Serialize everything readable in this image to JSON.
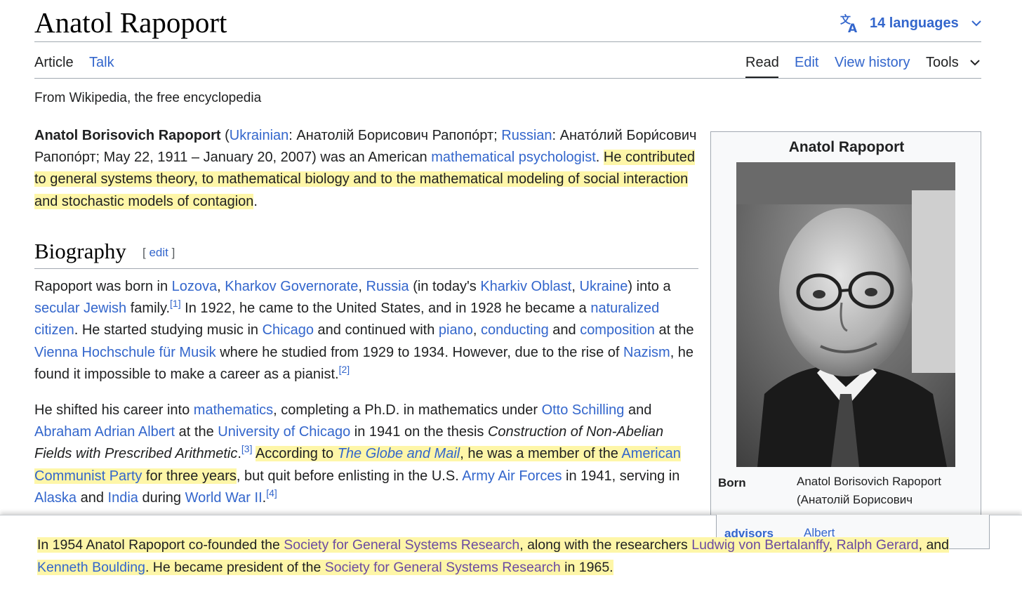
{
  "header": {
    "title": "Anatol Rapoport",
    "languages": "14 languages"
  },
  "tabs": {
    "article": "Article",
    "talk": "Talk",
    "read": "Read",
    "edit": "Edit",
    "history": "View history",
    "tools": "Tools"
  },
  "tagline": "From Wikipedia, the free encyclopedia",
  "lead": {
    "name": "Anatol Borisovich Rapoport",
    "ukr_link": "Ukrainian",
    "ukr_text": ": Анатолій Борисович Рапопо́рт; ",
    "rus_link": "Russian",
    "rus_text": ": Анато́лий Бори́сович Рапопо́рт; May 22, 1911 – January 20, 2007) was an American ",
    "psych_link": "mathematical psychologist",
    "hl_1": "He contributed to general systems theory, to mathematical biology and to the mathematical modeling of social interaction and stochastic models of contagion"
  },
  "biography": {
    "heading": "Biography",
    "edit_label": "edit",
    "p1": {
      "t1": "Rapoport was born in ",
      "l_lozova": "Lozova",
      "l_kharkov": "Kharkov Governorate",
      "l_russia": "Russia",
      "t2": " (in today's ",
      "l_oblast": "Kharkiv Oblast",
      "l_ukraine": "Ukraine",
      "t3": ") into a ",
      "l_secular": "secular Jewish",
      "t4": " family.",
      "ref1": "[1]",
      "t5": " In 1922, he came to the United States, and in 1928 he became a ",
      "l_natural": "naturalized citizen",
      "t6": ". He started studying music in ",
      "l_chicago": "Chicago",
      "t7": " and continued with ",
      "l_piano": "piano",
      "l_conducting": "conducting",
      "t8": " and ",
      "l_composition": "composition",
      "t9": " at the ",
      "l_vienna": "Vienna Hochschule für Musik",
      "t10": " where he studied from 1929 to 1934. However, due to the rise of ",
      "l_nazism": "Nazism",
      "t11": ", he found it impossible to make a career as a pianist.",
      "ref2": "[2]"
    },
    "p2": {
      "t1": "He shifted his career into ",
      "l_math": "mathematics",
      "t2": ", completing a Ph.D. in mathematics under ",
      "l_otto": "Otto Schilling",
      "t3": " and ",
      "l_albert": "Abraham Adrian Albert",
      "t4": " at the ",
      "l_uchicago": "University of Chicago",
      "t5": " in 1941 on the thesis ",
      "thesis": "Construction of Non-Abelian Fields with Prescribed Arithmetic",
      "t6": ".",
      "ref3": "[3]",
      "hl_a": "According to ",
      "l_globe": "The Globe and Mail",
      "hl_b": ", he was a member of the ",
      "l_acp": "American Communist Party",
      "hl_c": " for three years",
      "t7": ", but quit before enlisting in the U.S. ",
      "l_aaf": "Army Air Forces",
      "t8": " in 1941, serving in ",
      "l_alaska": "Alaska",
      "t9": " and ",
      "l_india": "India",
      "t10": " during ",
      "l_ww2": "World War II",
      "t11": ".",
      "ref4": "[4]"
    },
    "p3": {
      "t1": "In 1954 Anatol Rapoport co-founded the ",
      "l_sgsr": "Society for General Systems Research",
      "t2": ", along with the researchers ",
      "l_bertalanffy": "Ludwig von Bertalanffy",
      "l_gerard": "Ralph Gerard",
      "t3": ", and ",
      "l_boulding": "Kenneth Boulding",
      "t4": ". He became president of the ",
      "l_sgsr2": "Society for General Systems Research",
      "t5": " in 1965."
    }
  },
  "infobox": {
    "title": "Anatol Rapoport",
    "born_label": "Born",
    "born_line1": "Anatol Borisovich Rapoport",
    "born_line2": "(Анатолій Борисович",
    "advisors_label": "advisors",
    "advisors_value": "Albert"
  },
  "colors": {
    "link": "#3366cc",
    "visited_link": "#6b4ba1",
    "highlight": "#fef6a8"
  }
}
